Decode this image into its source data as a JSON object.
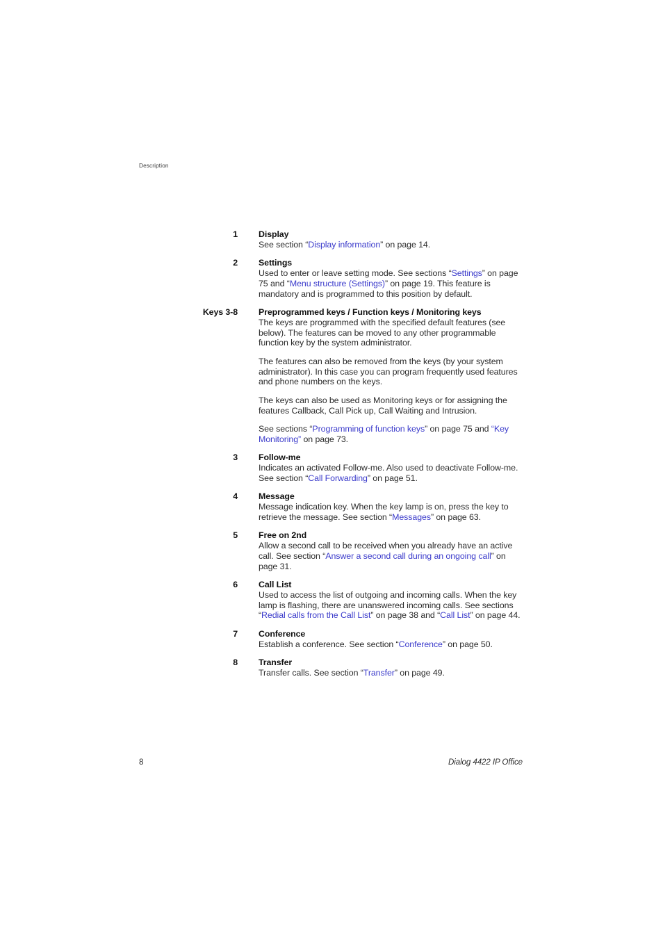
{
  "header": {
    "running_head": "Description"
  },
  "footer": {
    "page_number": "8",
    "document_title": "Dialog 4422 IP Office"
  },
  "colors": {
    "cross_reference_link": "#3b3bcb",
    "body_text": "#2b2b2b",
    "heading_text": "#111111",
    "running_head": "#3a3a3a",
    "page_background": "#ffffff"
  },
  "entries": [
    {
      "label": "1",
      "title": "Display",
      "paragraphs": [
        [
          {
            "t": "See section “",
            "link": false
          },
          {
            "t": "Display information",
            "link": true
          },
          {
            "t": "” on page 14.",
            "link": false
          }
        ]
      ]
    },
    {
      "label": "2",
      "title": "Settings",
      "paragraphs": [
        [
          {
            "t": "Used to enter or leave setting mode. See sections “",
            "link": false
          },
          {
            "t": "Settings",
            "link": true
          },
          {
            "t": "” on page 75 and “",
            "link": false
          },
          {
            "t": "Menu structure (Settings)",
            "link": true
          },
          {
            "t": "” on page 19. This feature is mandatory and is programmed to this position by default.",
            "link": false
          }
        ]
      ]
    },
    {
      "label": "Keys 3-8",
      "title": "Preprogrammed keys / Function keys / Monitoring keys",
      "paragraphs": [
        [
          {
            "t": "The keys are programmed with the specified default features (see below). The features can be moved to any other programmable function key by the system administrator.",
            "link": false
          }
        ],
        [
          {
            "t": "The features can also be removed from the keys (by your system administrator). In this case you can program frequently used features and phone numbers on the keys.",
            "link": false
          }
        ],
        [
          {
            "t": "The keys can also be used as Monitoring keys or for assigning the features Callback, Call Pick up, Call Waiting and Intrusion.",
            "link": false
          }
        ],
        [
          {
            "t": "See sections “",
            "link": false
          },
          {
            "t": "Programming of function keys",
            "link": true
          },
          {
            "t": "” on page 75 and ",
            "link": false
          },
          {
            "t": "“Key Monitoring”",
            "link": true
          },
          {
            "t": " on page 73.",
            "link": false
          }
        ]
      ]
    },
    {
      "label": "3",
      "title": "Follow-me",
      "paragraphs": [
        [
          {
            "t": "Indicates an activated Follow-me. Also used to deactivate Follow-me. See section “",
            "link": false
          },
          {
            "t": "Call Forwarding",
            "link": true
          },
          {
            "t": "” on page 51.",
            "link": false
          }
        ]
      ]
    },
    {
      "label": "4",
      "title": "Message",
      "paragraphs": [
        [
          {
            "t": "Message indication key. When the key lamp is on, press the key to retrieve the message. See section “",
            "link": false
          },
          {
            "t": "Messages",
            "link": true
          },
          {
            "t": "” on page 63.",
            "link": false
          }
        ]
      ]
    },
    {
      "label": "5",
      "title": "Free on 2nd",
      "paragraphs": [
        [
          {
            "t": "Allow a second call to be received when you already have an active call. See section “",
            "link": false
          },
          {
            "t": "Answer a second call during an ongoing call",
            "link": true
          },
          {
            "t": "” on page 31.",
            "link": false
          }
        ]
      ]
    },
    {
      "label": "6",
      "title": "Call List",
      "paragraphs": [
        [
          {
            "t": "Used to access the list of outgoing and incoming calls. When the key lamp is flashing, there are unanswered incoming calls. See sections “",
            "link": false
          },
          {
            "t": "Redial calls from the Call List",
            "link": true
          },
          {
            "t": "” on page 38 and “",
            "link": false
          },
          {
            "t": "Call List",
            "link": true
          },
          {
            "t": "” on page 44.",
            "link": false
          }
        ]
      ]
    },
    {
      "label": "7",
      "title": "Conference",
      "paragraphs": [
        [
          {
            "t": "Establish a conference. See section “",
            "link": false
          },
          {
            "t": "Conference",
            "link": true
          },
          {
            "t": "” on page 50.",
            "link": false
          }
        ]
      ]
    },
    {
      "label": "8",
      "title": "Transfer",
      "paragraphs": [
        [
          {
            "t": "Transfer calls. See section “",
            "link": false
          },
          {
            "t": "Transfer",
            "link": true
          },
          {
            "t": "” on page 49.",
            "link": false
          }
        ]
      ]
    }
  ]
}
